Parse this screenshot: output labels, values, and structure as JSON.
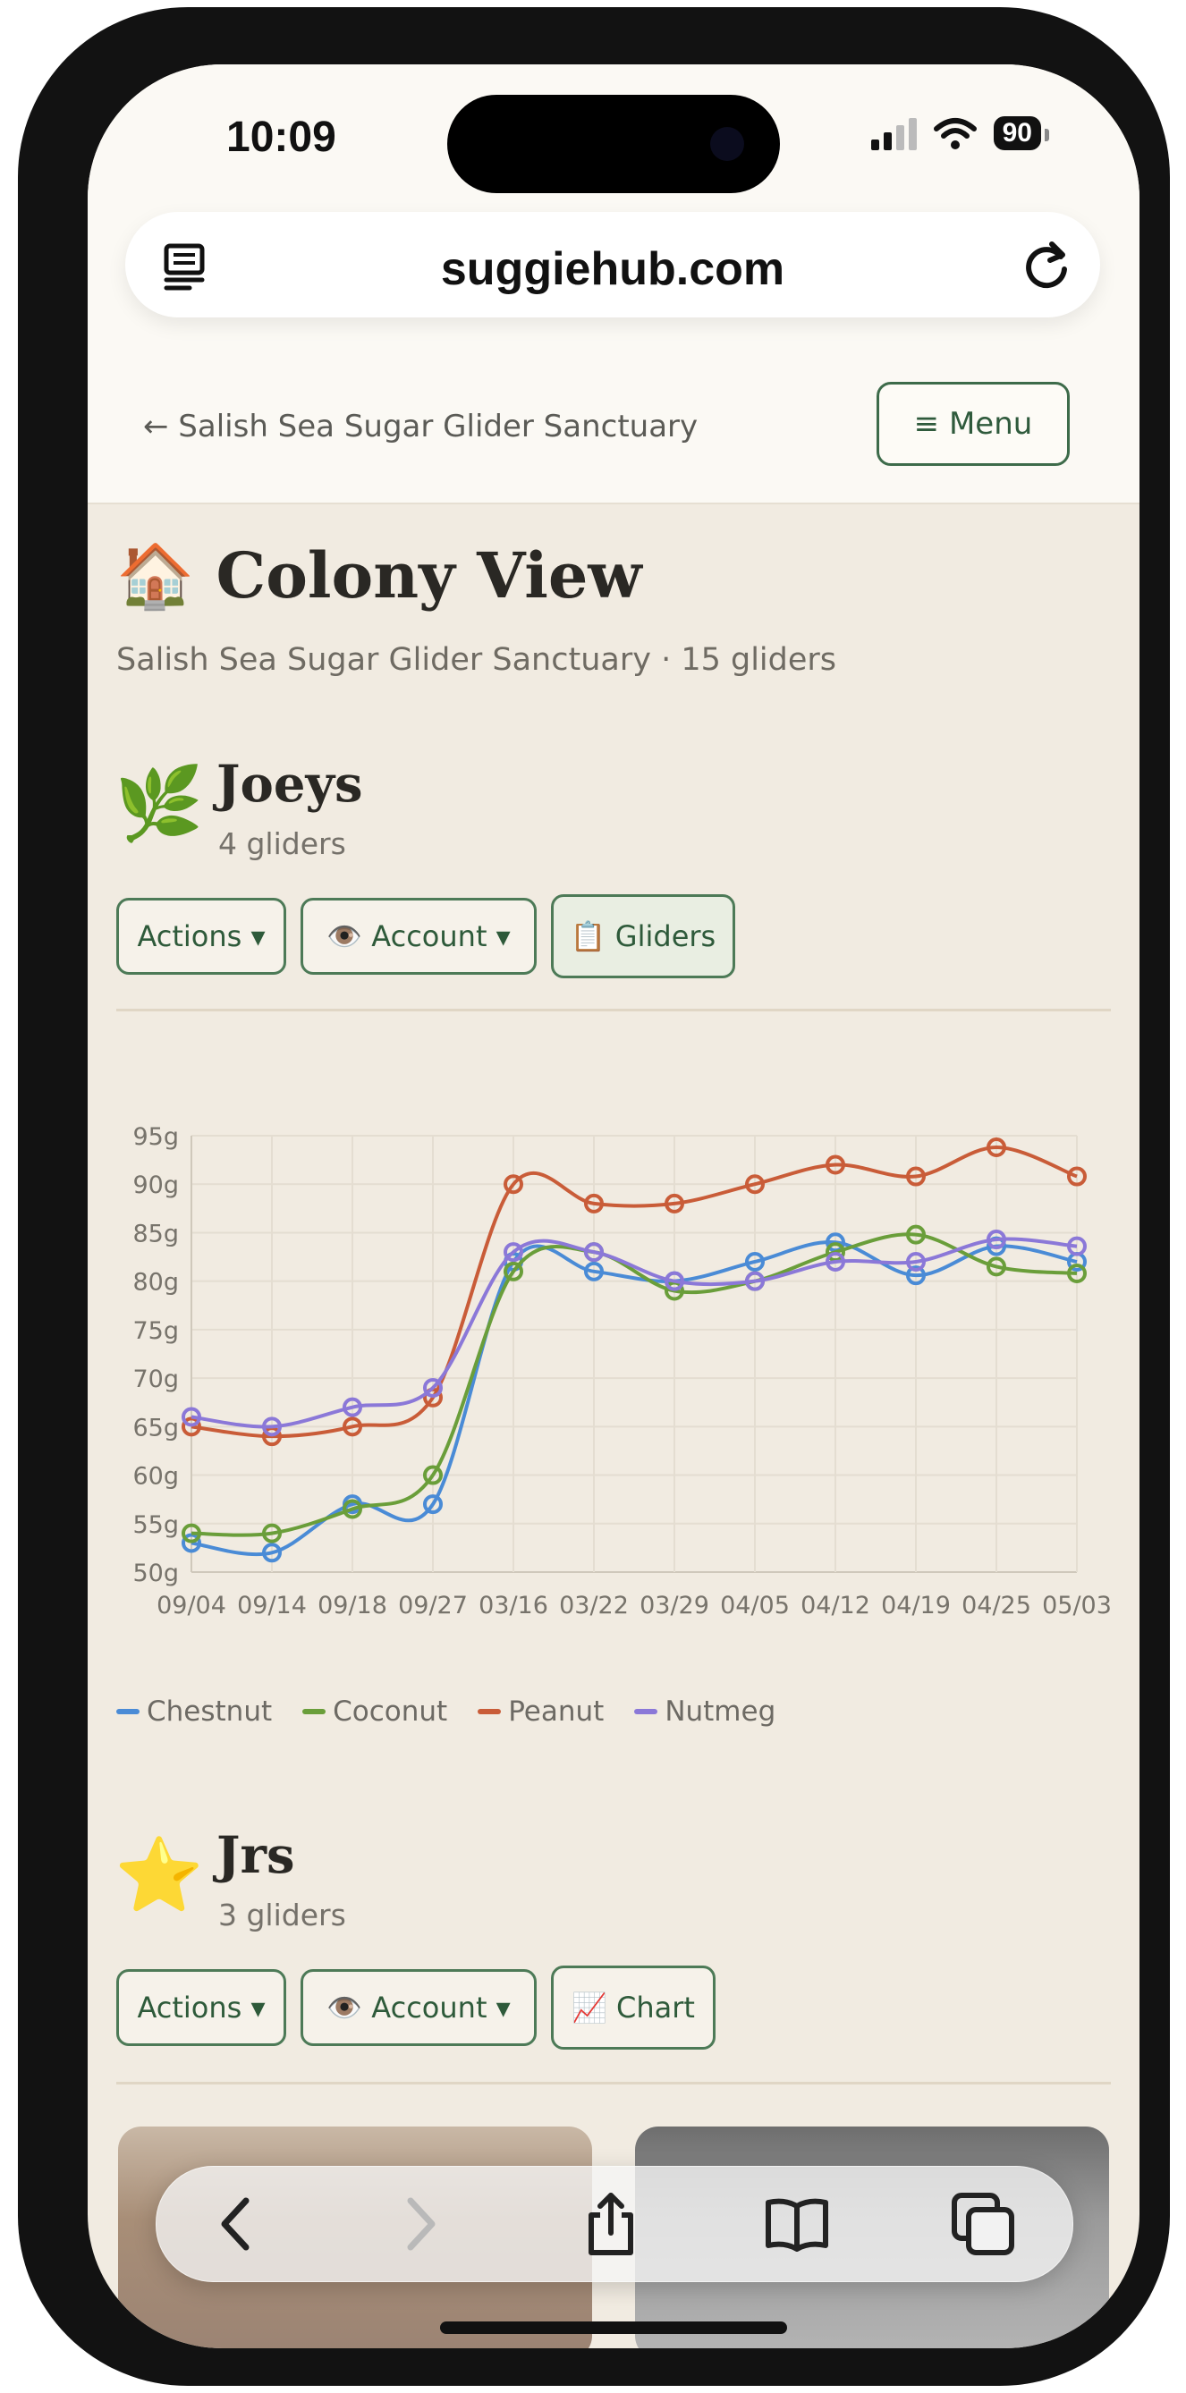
{
  "status_bar": {
    "time": "10:09",
    "battery": "90"
  },
  "browser": {
    "url": "suggiehub.com"
  },
  "header": {
    "back_link": "← Salish Sea Sugar Glider Sanctuary",
    "menu_label": "≡ Menu"
  },
  "page": {
    "title": "🏠 Colony View",
    "subtitle": "Salish Sea Sugar Glider Sanctuary · 15 gliders"
  },
  "groups": [
    {
      "emoji": "🌿",
      "name": "Joeys",
      "count": "4 gliders",
      "buttons": [
        "Actions ▾",
        "👁️ Account ▾",
        "📋 Gliders"
      ]
    },
    {
      "emoji": "⭐",
      "name": "Jrs",
      "count": "3 gliders",
      "buttons": [
        "Actions ▾",
        "👁️ Account ▾",
        "📈 Chart"
      ]
    }
  ],
  "chart_data": {
    "type": "line",
    "title": "",
    "xlabel": "",
    "ylabel": "",
    "categories": [
      "09/04",
      "09/14",
      "09/18",
      "09/27",
      "03/16",
      "03/22",
      "03/29",
      "04/05",
      "04/12",
      "04/19",
      "04/25",
      "05/03"
    ],
    "y_ticks": [
      "50g",
      "55g",
      "60g",
      "65g",
      "70g",
      "75g",
      "80g",
      "85g",
      "90g",
      "95g"
    ],
    "ylim": [
      50,
      95
    ],
    "grid": true,
    "legend_position": "bottom-left",
    "series": [
      {
        "name": "Chestnut",
        "color": "#4a8bd6",
        "values": [
          53,
          52,
          57,
          57,
          82,
          81,
          80,
          82,
          84,
          80.6,
          83.6,
          82
        ]
      },
      {
        "name": "Coconut",
        "color": "#6a9e3a",
        "values": [
          54,
          54,
          56.5,
          60,
          81,
          83,
          79,
          80,
          83,
          84.8,
          81.5,
          80.8
        ]
      },
      {
        "name": "Peanut",
        "color": "#c95c38",
        "values": [
          65,
          64,
          65,
          68,
          90,
          88,
          88,
          90,
          92,
          90.8,
          93.8,
          90.8
        ]
      },
      {
        "name": "Nutmeg",
        "color": "#8b78d8",
        "values": [
          66,
          65,
          67,
          69,
          83,
          83,
          80,
          80,
          82,
          82,
          84.3,
          83.6
        ]
      }
    ]
  }
}
